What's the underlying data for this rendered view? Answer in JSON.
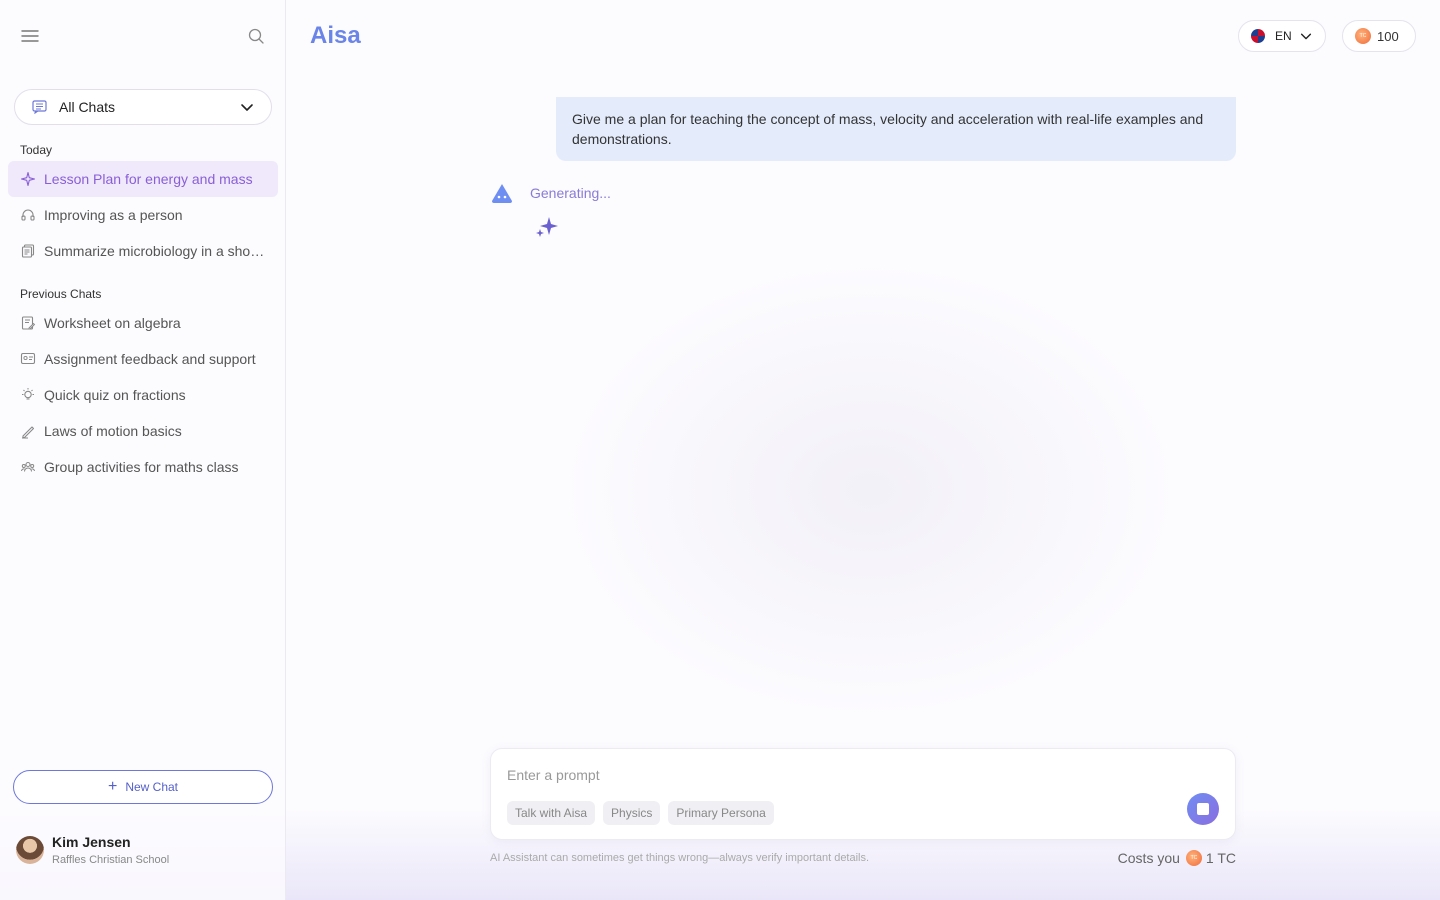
{
  "app": {
    "title": "Aisa"
  },
  "header": {
    "language": "EN",
    "credits": "100",
    "coin_mark": "TC"
  },
  "sidebar": {
    "filter_label": "All Chats",
    "sections": {
      "today": "Today",
      "previous": "Previous Chats"
    },
    "today_items": [
      {
        "label": "Lesson Plan for energy and mass",
        "icon": "sparkle-icon",
        "active": true
      },
      {
        "label": "Improving as a person",
        "icon": "headset-icon"
      },
      {
        "label": "Summarize microbiology in a short...",
        "icon": "copy-icon"
      }
    ],
    "previous_items": [
      {
        "label": "Worksheet on algebra",
        "icon": "edit-document-icon"
      },
      {
        "label": "Assignment feedback and support",
        "icon": "feedback-icon"
      },
      {
        "label": "Quick quiz on fractions",
        "icon": "lightbulb-icon"
      },
      {
        "label": "Laws of motion basics",
        "icon": "pen-icon"
      },
      {
        "label": "Group activities for maths class",
        "icon": "group-icon"
      }
    ],
    "new_chat_label": "New Chat",
    "user": {
      "name": "Kim Jensen",
      "school": "Raffles Christian School"
    }
  },
  "chat": {
    "user_message": "Give me a plan for teaching the concept of mass, velocity and acceleration with real-life examples and demonstrations.",
    "status": "Generating..."
  },
  "composer": {
    "placeholder": "Enter a prompt",
    "value": "",
    "chips": [
      "Talk with Aisa",
      "Physics",
      "Primary Persona"
    ],
    "disclaimer": "AI Assistant can sometimes get things wrong—always verify important details.",
    "cost_label": "Costs you",
    "cost_value": "1 TC"
  },
  "colors": {
    "accent": "#6a84e8",
    "active_item_bg": "#efe9fb",
    "active_item_text": "#8a5fd6",
    "user_bubble": "#e4ecfc"
  }
}
